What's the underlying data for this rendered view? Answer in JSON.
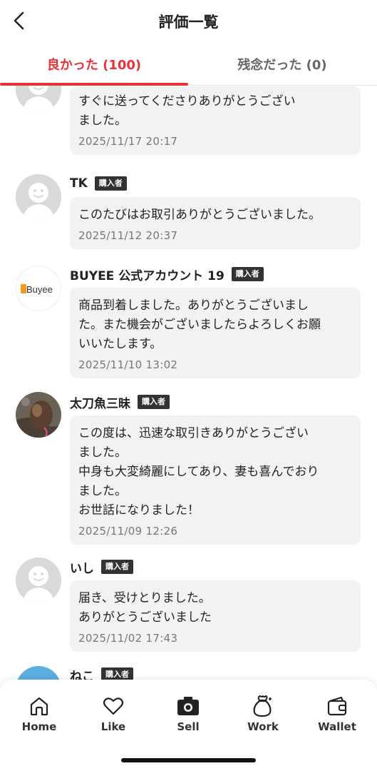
{
  "header": {
    "title": "評価一覧"
  },
  "tabs": [
    {
      "label": "良かった (100)",
      "active": true
    },
    {
      "label": "残念だった (0)",
      "active": false
    }
  ],
  "badge_label": "購入者",
  "reviews": [
    {
      "name": "",
      "comment": "すぐに送ってくださりありがとうござい\nました。",
      "date": "2025/11/17 20:17",
      "avatar": "default-avatar-icon"
    },
    {
      "name": "TK",
      "comment": "このたびはお取引ありがとうございました。",
      "date": "2025/11/12 20:37",
      "avatar": "default-avatar-icon"
    },
    {
      "name": "BUYEE 公式アカウント 19",
      "comment": "商品到着しました。ありがとうございまし\nた。また機会がございましたらよろしくお願\nいいたします。",
      "date": "2025/11/10 13:02",
      "avatar": "buyee-logo",
      "avatar_text": "Buyee"
    },
    {
      "name": "太刀魚三昧",
      "comment": "この度は、迅速な取引きありがとうござい\nました。\n中身も大変綺麗にしてあり、妻も喜んでおり\nました。\nお世話になりました！",
      "date": "2025/11/09 12:26",
      "avatar": "cat-photo"
    },
    {
      "name": "いし",
      "comment": "届き、受けとりました。\nありがとうございました",
      "date": "2025/11/02 17:43",
      "avatar": "default-avatar-icon"
    },
    {
      "name": "ねこ",
      "comment": "",
      "date": "",
      "avatar": "blue-avatar"
    }
  ],
  "nav": [
    {
      "label": "Home",
      "icon": "home-icon"
    },
    {
      "label": "Like",
      "icon": "heart-icon"
    },
    {
      "label": "Sell",
      "icon": "camera-icon"
    },
    {
      "label": "Work",
      "icon": "money-bag-icon"
    },
    {
      "label": "Wallet",
      "icon": "wallet-icon"
    }
  ],
  "colors": {
    "accent": "#e8323a",
    "bubble": "#f2f2f3",
    "badge": "#333333"
  }
}
